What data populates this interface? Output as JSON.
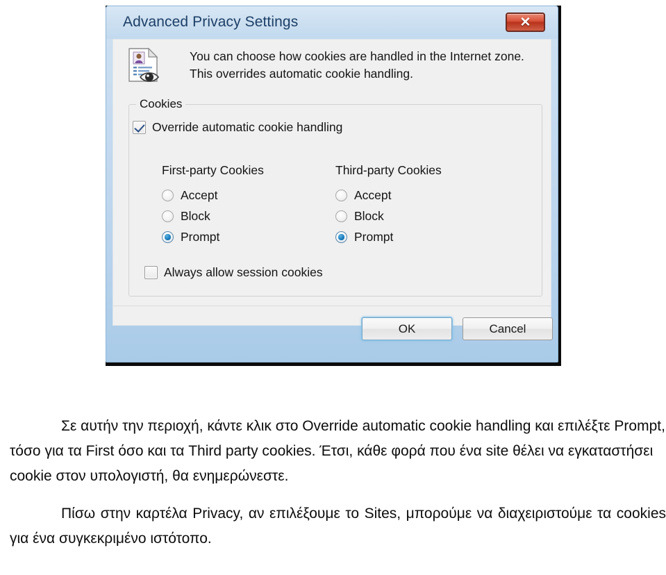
{
  "dialog": {
    "title": "Advanced Privacy Settings",
    "close_button_label": "✕",
    "icon_name": "privacy-document-icon",
    "description": "You can choose how cookies are handled in the Internet zone.  This overrides automatic cookie handling.",
    "group": {
      "legend": "Cookies",
      "override_checkbox": {
        "label": "Override automatic cookie handling",
        "checked": true
      },
      "session_checkbox": {
        "label": "Always allow session cookies",
        "checked": false
      },
      "columns": [
        {
          "heading": "First-party Cookies",
          "options": [
            {
              "label": "Accept",
              "selected": false
            },
            {
              "label": "Block",
              "selected": false
            },
            {
              "label": "Prompt",
              "selected": true
            }
          ]
        },
        {
          "heading": "Third-party Cookies",
          "options": [
            {
              "label": "Accept",
              "selected": false
            },
            {
              "label": "Block",
              "selected": false
            },
            {
              "label": "Prompt",
              "selected": true
            }
          ]
        }
      ]
    },
    "buttons": {
      "ok": "OK",
      "cancel": "Cancel"
    }
  },
  "colors": {
    "title_bar": "#cde0f1",
    "dialog_border": "#8fb6d6",
    "close_button": "#d9533a",
    "radio_selected": "#1c7fc0",
    "checkbox_check": "#2a4f86",
    "default_button_focus": "#8fc6e8",
    "body_background": "#f0f0f0"
  },
  "prose": {
    "paragraph1": "Σε αυτήν την περιοχή, κάντε κλικ στο Override automatic cookie handling και επιλέξτε Prompt, τόσο για τα First όσο και τα Third party cookies. Έτσι, κάθε φορά που ένα site θέλει να εγκαταστήσει cookie στον υπολογιστή, θα ενημερώνεστε.",
    "paragraph2": "Πίσω στην καρτέλα Privacy, αν επιλέξουμε το Sites, μπορούμε να διαχειριστούμε τα cookies για ένα συγκεκριμένο ιστότοπο."
  }
}
